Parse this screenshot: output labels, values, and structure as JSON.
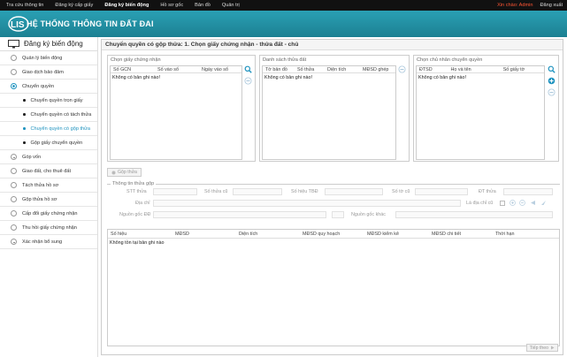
{
  "nav": {
    "items": [
      "Tra cứu thông tin",
      "Đăng ký cấp giấy",
      "Đăng ký biến động",
      "Hồ sơ gốc",
      "Bản đồ",
      "Quản trị"
    ],
    "active_index": 2,
    "greeting": "Xin chào: Admin",
    "logout": "Đăng xuất"
  },
  "banner": {
    "logo_text": "HỆ THỐNG THÔNG TIN ĐẤT ĐAI",
    "logo_letters": "LIS"
  },
  "sidebar": {
    "title": "Đăng ký biến động",
    "items_before": [
      "Quản lý biến động",
      "Giao dịch bảo đảm"
    ],
    "open_item": "Chuyển quyền",
    "subitems": [
      "Chuyển quyền trọn giấy",
      "Chuyển quyền có tách thửa",
      "Chuyển quyền có gộp thửa",
      "Gộp giấy chuyển quyền"
    ],
    "active_sub_index": 2,
    "items_after": [
      "Góp vốn",
      "Giao đất, cho thuê đất",
      "Tách thửa hồ sơ",
      "Gộp thửa hồ sơ",
      "Cấp đổi giấy chứng nhận",
      "Thu hồi giấy chứng nhận",
      "Xác nhận bổ sung"
    ]
  },
  "main": {
    "title": "Chuyển quyền có gộp thửa: 1. Chọn giấy chứng nhận - thửa đất - chủ",
    "panel1": {
      "title": "Chọn giấy chứng nhận",
      "columns": [
        "Số GCN",
        "Số vào sổ",
        "Ngày vào sổ"
      ],
      "empty": "Không có bản ghi nào!"
    },
    "panel2": {
      "title": "Danh sách thửa đất",
      "columns": [
        "Tờ bản đồ",
        "Số thửa",
        "Diện tích",
        "MĐSD ghép"
      ],
      "empty": "Không có bản ghi nào!"
    },
    "panel3": {
      "title": "Chọn chủ nhân chuyển quyền",
      "columns": [
        "ĐTSD",
        "Họ và tên",
        "Số giấy tờ"
      ],
      "empty": "Không có bản ghi nào!"
    },
    "merge_button": "Gộp thửa",
    "info": {
      "legend": "Thông tin thửa gộp",
      "row1": [
        "STT thửa",
        "Số thửa cũ",
        "Số hiệu TBĐ",
        "Số tờ cũ",
        "ĐT thửa"
      ],
      "row2": [
        "Địa chỉ",
        "Là địa chỉ cũ"
      ],
      "row3": [
        "Nguồn gốc ĐĐ",
        "Nguồn gốc khác"
      ]
    },
    "bottom_grid": {
      "columns": [
        "Số hiệu",
        "MĐSD",
        "Diện tích",
        "MĐSD quy hoạch",
        "MĐSD kiểm kê",
        "MĐSD chi tiết",
        "Thời hạn"
      ],
      "empty": "Không tồn tại bản ghi nào"
    },
    "next_button": "Tiếp theo"
  },
  "colors": {
    "banner": "#2aa0b4",
    "accent": "#1f93bf",
    "greeting": "#ff5533",
    "topbar": "#111111"
  }
}
